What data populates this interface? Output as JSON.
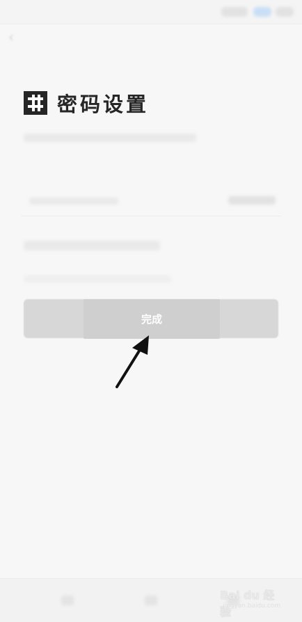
{
  "header": {
    "title": "密码设置"
  },
  "actions": {
    "done_label": "完成"
  },
  "watermark": {
    "text": "Bai du 经验",
    "sub": "jingyan.baidu.com"
  },
  "icons": {
    "header": "hash-icon",
    "back": "back-arrow-icon",
    "pointer": "arrow-icon"
  },
  "colors": {
    "button_disabled": "#d7d7d7",
    "title": "#262626",
    "background": "#f7f7f7"
  }
}
